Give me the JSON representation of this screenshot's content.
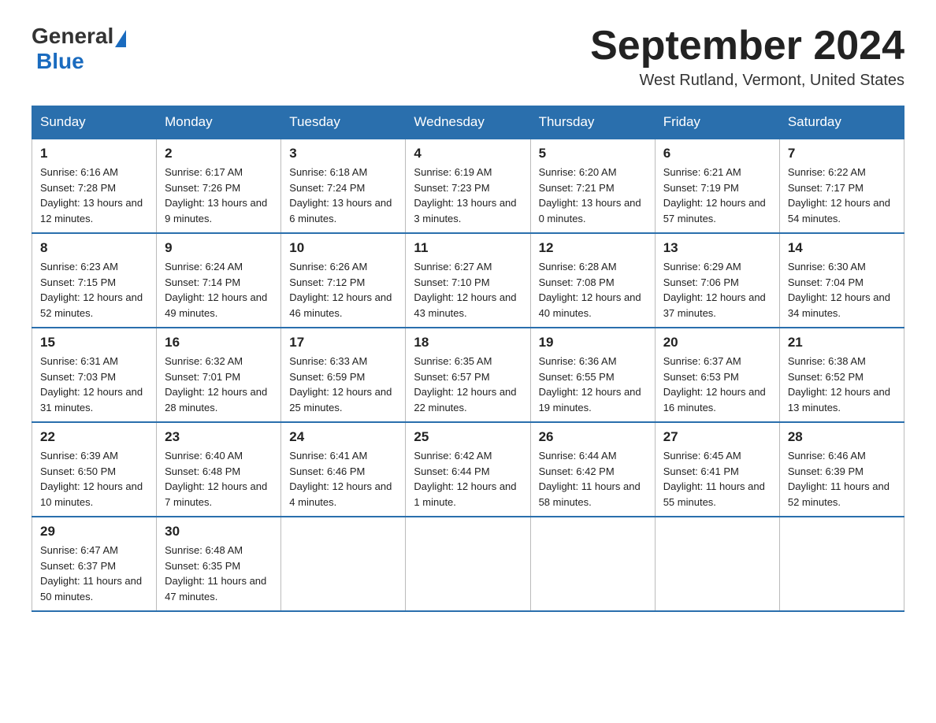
{
  "header": {
    "logo_general": "General",
    "logo_blue": "Blue",
    "month_title": "September 2024",
    "location": "West Rutland, Vermont, United States"
  },
  "weekdays": [
    "Sunday",
    "Monday",
    "Tuesday",
    "Wednesday",
    "Thursday",
    "Friday",
    "Saturday"
  ],
  "weeks": [
    [
      {
        "day": "1",
        "sunrise": "6:16 AM",
        "sunset": "7:28 PM",
        "daylight": "13 hours and 12 minutes."
      },
      {
        "day": "2",
        "sunrise": "6:17 AM",
        "sunset": "7:26 PM",
        "daylight": "13 hours and 9 minutes."
      },
      {
        "day": "3",
        "sunrise": "6:18 AM",
        "sunset": "7:24 PM",
        "daylight": "13 hours and 6 minutes."
      },
      {
        "day": "4",
        "sunrise": "6:19 AM",
        "sunset": "7:23 PM",
        "daylight": "13 hours and 3 minutes."
      },
      {
        "day": "5",
        "sunrise": "6:20 AM",
        "sunset": "7:21 PM",
        "daylight": "13 hours and 0 minutes."
      },
      {
        "day": "6",
        "sunrise": "6:21 AM",
        "sunset": "7:19 PM",
        "daylight": "12 hours and 57 minutes."
      },
      {
        "day": "7",
        "sunrise": "6:22 AM",
        "sunset": "7:17 PM",
        "daylight": "12 hours and 54 minutes."
      }
    ],
    [
      {
        "day": "8",
        "sunrise": "6:23 AM",
        "sunset": "7:15 PM",
        "daylight": "12 hours and 52 minutes."
      },
      {
        "day": "9",
        "sunrise": "6:24 AM",
        "sunset": "7:14 PM",
        "daylight": "12 hours and 49 minutes."
      },
      {
        "day": "10",
        "sunrise": "6:26 AM",
        "sunset": "7:12 PM",
        "daylight": "12 hours and 46 minutes."
      },
      {
        "day": "11",
        "sunrise": "6:27 AM",
        "sunset": "7:10 PM",
        "daylight": "12 hours and 43 minutes."
      },
      {
        "day": "12",
        "sunrise": "6:28 AM",
        "sunset": "7:08 PM",
        "daylight": "12 hours and 40 minutes."
      },
      {
        "day": "13",
        "sunrise": "6:29 AM",
        "sunset": "7:06 PM",
        "daylight": "12 hours and 37 minutes."
      },
      {
        "day": "14",
        "sunrise": "6:30 AM",
        "sunset": "7:04 PM",
        "daylight": "12 hours and 34 minutes."
      }
    ],
    [
      {
        "day": "15",
        "sunrise": "6:31 AM",
        "sunset": "7:03 PM",
        "daylight": "12 hours and 31 minutes."
      },
      {
        "day": "16",
        "sunrise": "6:32 AM",
        "sunset": "7:01 PM",
        "daylight": "12 hours and 28 minutes."
      },
      {
        "day": "17",
        "sunrise": "6:33 AM",
        "sunset": "6:59 PM",
        "daylight": "12 hours and 25 minutes."
      },
      {
        "day": "18",
        "sunrise": "6:35 AM",
        "sunset": "6:57 PM",
        "daylight": "12 hours and 22 minutes."
      },
      {
        "day": "19",
        "sunrise": "6:36 AM",
        "sunset": "6:55 PM",
        "daylight": "12 hours and 19 minutes."
      },
      {
        "day": "20",
        "sunrise": "6:37 AM",
        "sunset": "6:53 PM",
        "daylight": "12 hours and 16 minutes."
      },
      {
        "day": "21",
        "sunrise": "6:38 AM",
        "sunset": "6:52 PM",
        "daylight": "12 hours and 13 minutes."
      }
    ],
    [
      {
        "day": "22",
        "sunrise": "6:39 AM",
        "sunset": "6:50 PM",
        "daylight": "12 hours and 10 minutes."
      },
      {
        "day": "23",
        "sunrise": "6:40 AM",
        "sunset": "6:48 PM",
        "daylight": "12 hours and 7 minutes."
      },
      {
        "day": "24",
        "sunrise": "6:41 AM",
        "sunset": "6:46 PM",
        "daylight": "12 hours and 4 minutes."
      },
      {
        "day": "25",
        "sunrise": "6:42 AM",
        "sunset": "6:44 PM",
        "daylight": "12 hours and 1 minute."
      },
      {
        "day": "26",
        "sunrise": "6:44 AM",
        "sunset": "6:42 PM",
        "daylight": "11 hours and 58 minutes."
      },
      {
        "day": "27",
        "sunrise": "6:45 AM",
        "sunset": "6:41 PM",
        "daylight": "11 hours and 55 minutes."
      },
      {
        "day": "28",
        "sunrise": "6:46 AM",
        "sunset": "6:39 PM",
        "daylight": "11 hours and 52 minutes."
      }
    ],
    [
      {
        "day": "29",
        "sunrise": "6:47 AM",
        "sunset": "6:37 PM",
        "daylight": "11 hours and 50 minutes."
      },
      {
        "day": "30",
        "sunrise": "6:48 AM",
        "sunset": "6:35 PM",
        "daylight": "11 hours and 47 minutes."
      },
      null,
      null,
      null,
      null,
      null
    ]
  ],
  "labels": {
    "sunrise": "Sunrise: ",
    "sunset": "Sunset: ",
    "daylight": "Daylight: "
  }
}
